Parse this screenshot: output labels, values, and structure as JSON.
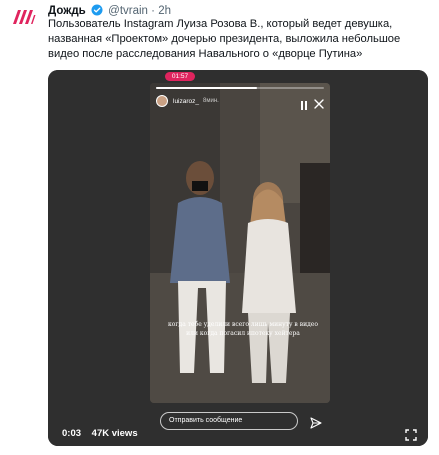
{
  "tweet": {
    "author_name": "Дождь",
    "handle": "@tvrain",
    "separator": "·",
    "time": "2h",
    "text": "Пользователь Instagram Луиза Розова В., который ведет девушка, названная «Проектом» дочерью президента, выложила небольшое видео после расследования Навального о «дворце Путина»"
  },
  "media": {
    "phone_time": "01:57",
    "story_username": "luizaroz_",
    "story_time": "8мин.",
    "caption": "когда тебе уделили всего лишь минуту в видео или когда погасил ипотеку хейтера",
    "reply_placeholder": "Отправить сообщение",
    "story_progress": 0.6,
    "duration": "0:03",
    "views": "47K views"
  },
  "colors": {
    "brand": "#e0245e",
    "verified": "#1d9bf0",
    "text_secondary": "#536471"
  },
  "icons": {
    "avatar": "tvrain-logo",
    "verified": "verified-badge-icon",
    "pause": "pause-icon",
    "close": "close-icon",
    "send": "send-icon",
    "fullscreen": "fullscreen-icon"
  }
}
